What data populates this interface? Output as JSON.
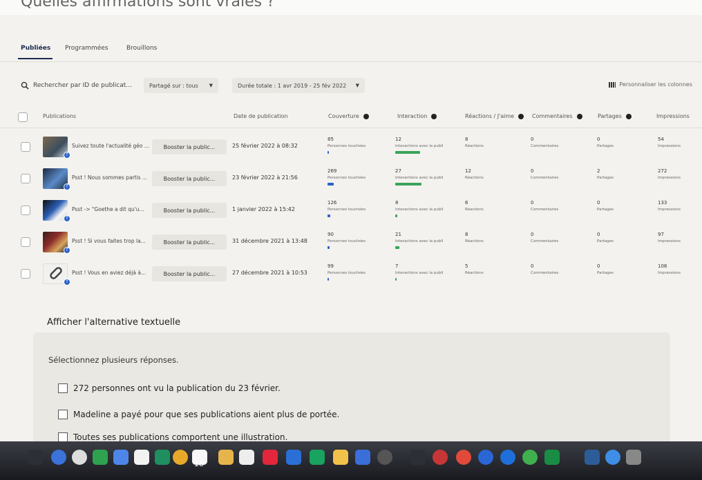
{
  "tabs": [
    "Publiées",
    "Programmées",
    "Brouillons"
  ],
  "filters": {
    "search_placeholder": "Rechercher par ID de publicat...",
    "shared_on": "Partagé sur : tous",
    "duration": "Durée totale : 1 avr 2019 - 25 fév 2022",
    "customize": "Personnaliser les colonnes"
  },
  "columns": {
    "publications": "Publications",
    "date": "Date de publication",
    "reach": "Couverture",
    "interaction": "Interaction",
    "reactions": "Réactions / J'aime",
    "comments": "Commentaires",
    "shares": "Partages",
    "impressions": "Impressions"
  },
  "rows": [
    {
      "text": "Suivez toute l'actualité géo ...",
      "boost": "Booster la public...",
      "date": "25 février 2022 à 08:32",
      "reach": "85",
      "interaction": "12",
      "reactions": "8",
      "comments": "0",
      "shares": "0",
      "impressions": "54",
      "reach_bar": 0.03,
      "interaction_bar": 0.9
    },
    {
      "text": "Psst ! Nous sommes partis ...",
      "boost": "Booster la public...",
      "date": "23 février 2022 à 21:56",
      "reach": "269",
      "interaction": "27",
      "reactions": "12",
      "comments": "0",
      "shares": "2",
      "impressions": "272",
      "reach_bar": 0.12,
      "interaction_bar": 0.95
    },
    {
      "text": "Psst -> \"Goethe a dit qu'u...",
      "boost": "Booster la public...",
      "date": "1 janvier 2022 à 15:42",
      "reach": "126",
      "interaction": "8",
      "reactions": "6",
      "comments": "0",
      "shares": "0",
      "impressions": "133",
      "reach_bar": 0.06,
      "interaction_bar": 0.08
    },
    {
      "text": "Psst ! Si vous faites trop la...",
      "boost": "Booster la public...",
      "date": "31 décembre 2021 à 13:48",
      "reach": "90",
      "interaction": "21",
      "reactions": "8",
      "comments": "0",
      "shares": "0",
      "impressions": "97",
      "reach_bar": 0.04,
      "interaction_bar": 0.15
    },
    {
      "text": "Psst ! Vous en aviez déjà à...",
      "boost": "Booster la public...",
      "date": "27 décembre 2021 à 10:53",
      "reach": "99",
      "interaction": "7",
      "reactions": "5",
      "comments": "0",
      "shares": "0",
      "impressions": "108",
      "reach_bar": 0.03,
      "interaction_bar": 0.02
    }
  ],
  "alt_text_link": "Afficher l'alternative textuelle",
  "question": {
    "instruction": "Sélectionnez plusieurs réponses.",
    "options": [
      "272 personnes ont vu la publication du 23 février.",
      "Madeline a payé pour que ses publications aient plus de portée.",
      "Toutes ses publications comportent une illustration."
    ]
  },
  "taskbar": {
    "calendar_day": "18"
  }
}
